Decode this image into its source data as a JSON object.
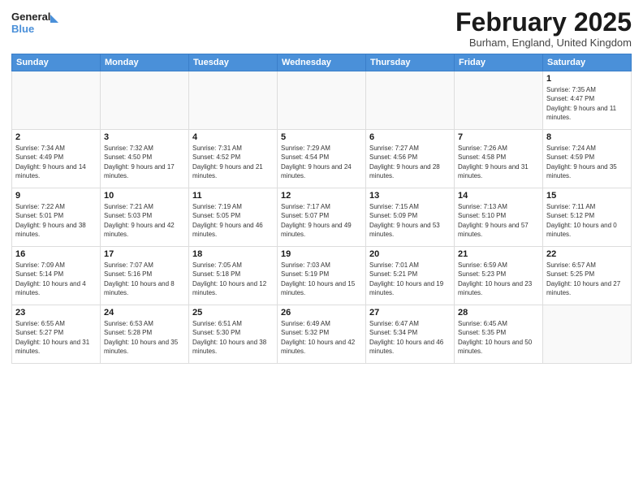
{
  "header": {
    "logo_line1": "General",
    "logo_line2": "Blue",
    "month_title": "February 2025",
    "location": "Burham, England, United Kingdom"
  },
  "weekdays": [
    "Sunday",
    "Monday",
    "Tuesday",
    "Wednesday",
    "Thursday",
    "Friday",
    "Saturday"
  ],
  "weeks": [
    [
      {
        "day": "",
        "info": ""
      },
      {
        "day": "",
        "info": ""
      },
      {
        "day": "",
        "info": ""
      },
      {
        "day": "",
        "info": ""
      },
      {
        "day": "",
        "info": ""
      },
      {
        "day": "",
        "info": ""
      },
      {
        "day": "1",
        "info": "Sunrise: 7:35 AM\nSunset: 4:47 PM\nDaylight: 9 hours and 11 minutes."
      }
    ],
    [
      {
        "day": "2",
        "info": "Sunrise: 7:34 AM\nSunset: 4:49 PM\nDaylight: 9 hours and 14 minutes."
      },
      {
        "day": "3",
        "info": "Sunrise: 7:32 AM\nSunset: 4:50 PM\nDaylight: 9 hours and 17 minutes."
      },
      {
        "day": "4",
        "info": "Sunrise: 7:31 AM\nSunset: 4:52 PM\nDaylight: 9 hours and 21 minutes."
      },
      {
        "day": "5",
        "info": "Sunrise: 7:29 AM\nSunset: 4:54 PM\nDaylight: 9 hours and 24 minutes."
      },
      {
        "day": "6",
        "info": "Sunrise: 7:27 AM\nSunset: 4:56 PM\nDaylight: 9 hours and 28 minutes."
      },
      {
        "day": "7",
        "info": "Sunrise: 7:26 AM\nSunset: 4:58 PM\nDaylight: 9 hours and 31 minutes."
      },
      {
        "day": "8",
        "info": "Sunrise: 7:24 AM\nSunset: 4:59 PM\nDaylight: 9 hours and 35 minutes."
      }
    ],
    [
      {
        "day": "9",
        "info": "Sunrise: 7:22 AM\nSunset: 5:01 PM\nDaylight: 9 hours and 38 minutes."
      },
      {
        "day": "10",
        "info": "Sunrise: 7:21 AM\nSunset: 5:03 PM\nDaylight: 9 hours and 42 minutes."
      },
      {
        "day": "11",
        "info": "Sunrise: 7:19 AM\nSunset: 5:05 PM\nDaylight: 9 hours and 46 minutes."
      },
      {
        "day": "12",
        "info": "Sunrise: 7:17 AM\nSunset: 5:07 PM\nDaylight: 9 hours and 49 minutes."
      },
      {
        "day": "13",
        "info": "Sunrise: 7:15 AM\nSunset: 5:09 PM\nDaylight: 9 hours and 53 minutes."
      },
      {
        "day": "14",
        "info": "Sunrise: 7:13 AM\nSunset: 5:10 PM\nDaylight: 9 hours and 57 minutes."
      },
      {
        "day": "15",
        "info": "Sunrise: 7:11 AM\nSunset: 5:12 PM\nDaylight: 10 hours and 0 minutes."
      }
    ],
    [
      {
        "day": "16",
        "info": "Sunrise: 7:09 AM\nSunset: 5:14 PM\nDaylight: 10 hours and 4 minutes."
      },
      {
        "day": "17",
        "info": "Sunrise: 7:07 AM\nSunset: 5:16 PM\nDaylight: 10 hours and 8 minutes."
      },
      {
        "day": "18",
        "info": "Sunrise: 7:05 AM\nSunset: 5:18 PM\nDaylight: 10 hours and 12 minutes."
      },
      {
        "day": "19",
        "info": "Sunrise: 7:03 AM\nSunset: 5:19 PM\nDaylight: 10 hours and 15 minutes."
      },
      {
        "day": "20",
        "info": "Sunrise: 7:01 AM\nSunset: 5:21 PM\nDaylight: 10 hours and 19 minutes."
      },
      {
        "day": "21",
        "info": "Sunrise: 6:59 AM\nSunset: 5:23 PM\nDaylight: 10 hours and 23 minutes."
      },
      {
        "day": "22",
        "info": "Sunrise: 6:57 AM\nSunset: 5:25 PM\nDaylight: 10 hours and 27 minutes."
      }
    ],
    [
      {
        "day": "23",
        "info": "Sunrise: 6:55 AM\nSunset: 5:27 PM\nDaylight: 10 hours and 31 minutes."
      },
      {
        "day": "24",
        "info": "Sunrise: 6:53 AM\nSunset: 5:28 PM\nDaylight: 10 hours and 35 minutes."
      },
      {
        "day": "25",
        "info": "Sunrise: 6:51 AM\nSunset: 5:30 PM\nDaylight: 10 hours and 38 minutes."
      },
      {
        "day": "26",
        "info": "Sunrise: 6:49 AM\nSunset: 5:32 PM\nDaylight: 10 hours and 42 minutes."
      },
      {
        "day": "27",
        "info": "Sunrise: 6:47 AM\nSunset: 5:34 PM\nDaylight: 10 hours and 46 minutes."
      },
      {
        "day": "28",
        "info": "Sunrise: 6:45 AM\nSunset: 5:35 PM\nDaylight: 10 hours and 50 minutes."
      },
      {
        "day": "",
        "info": ""
      }
    ]
  ]
}
